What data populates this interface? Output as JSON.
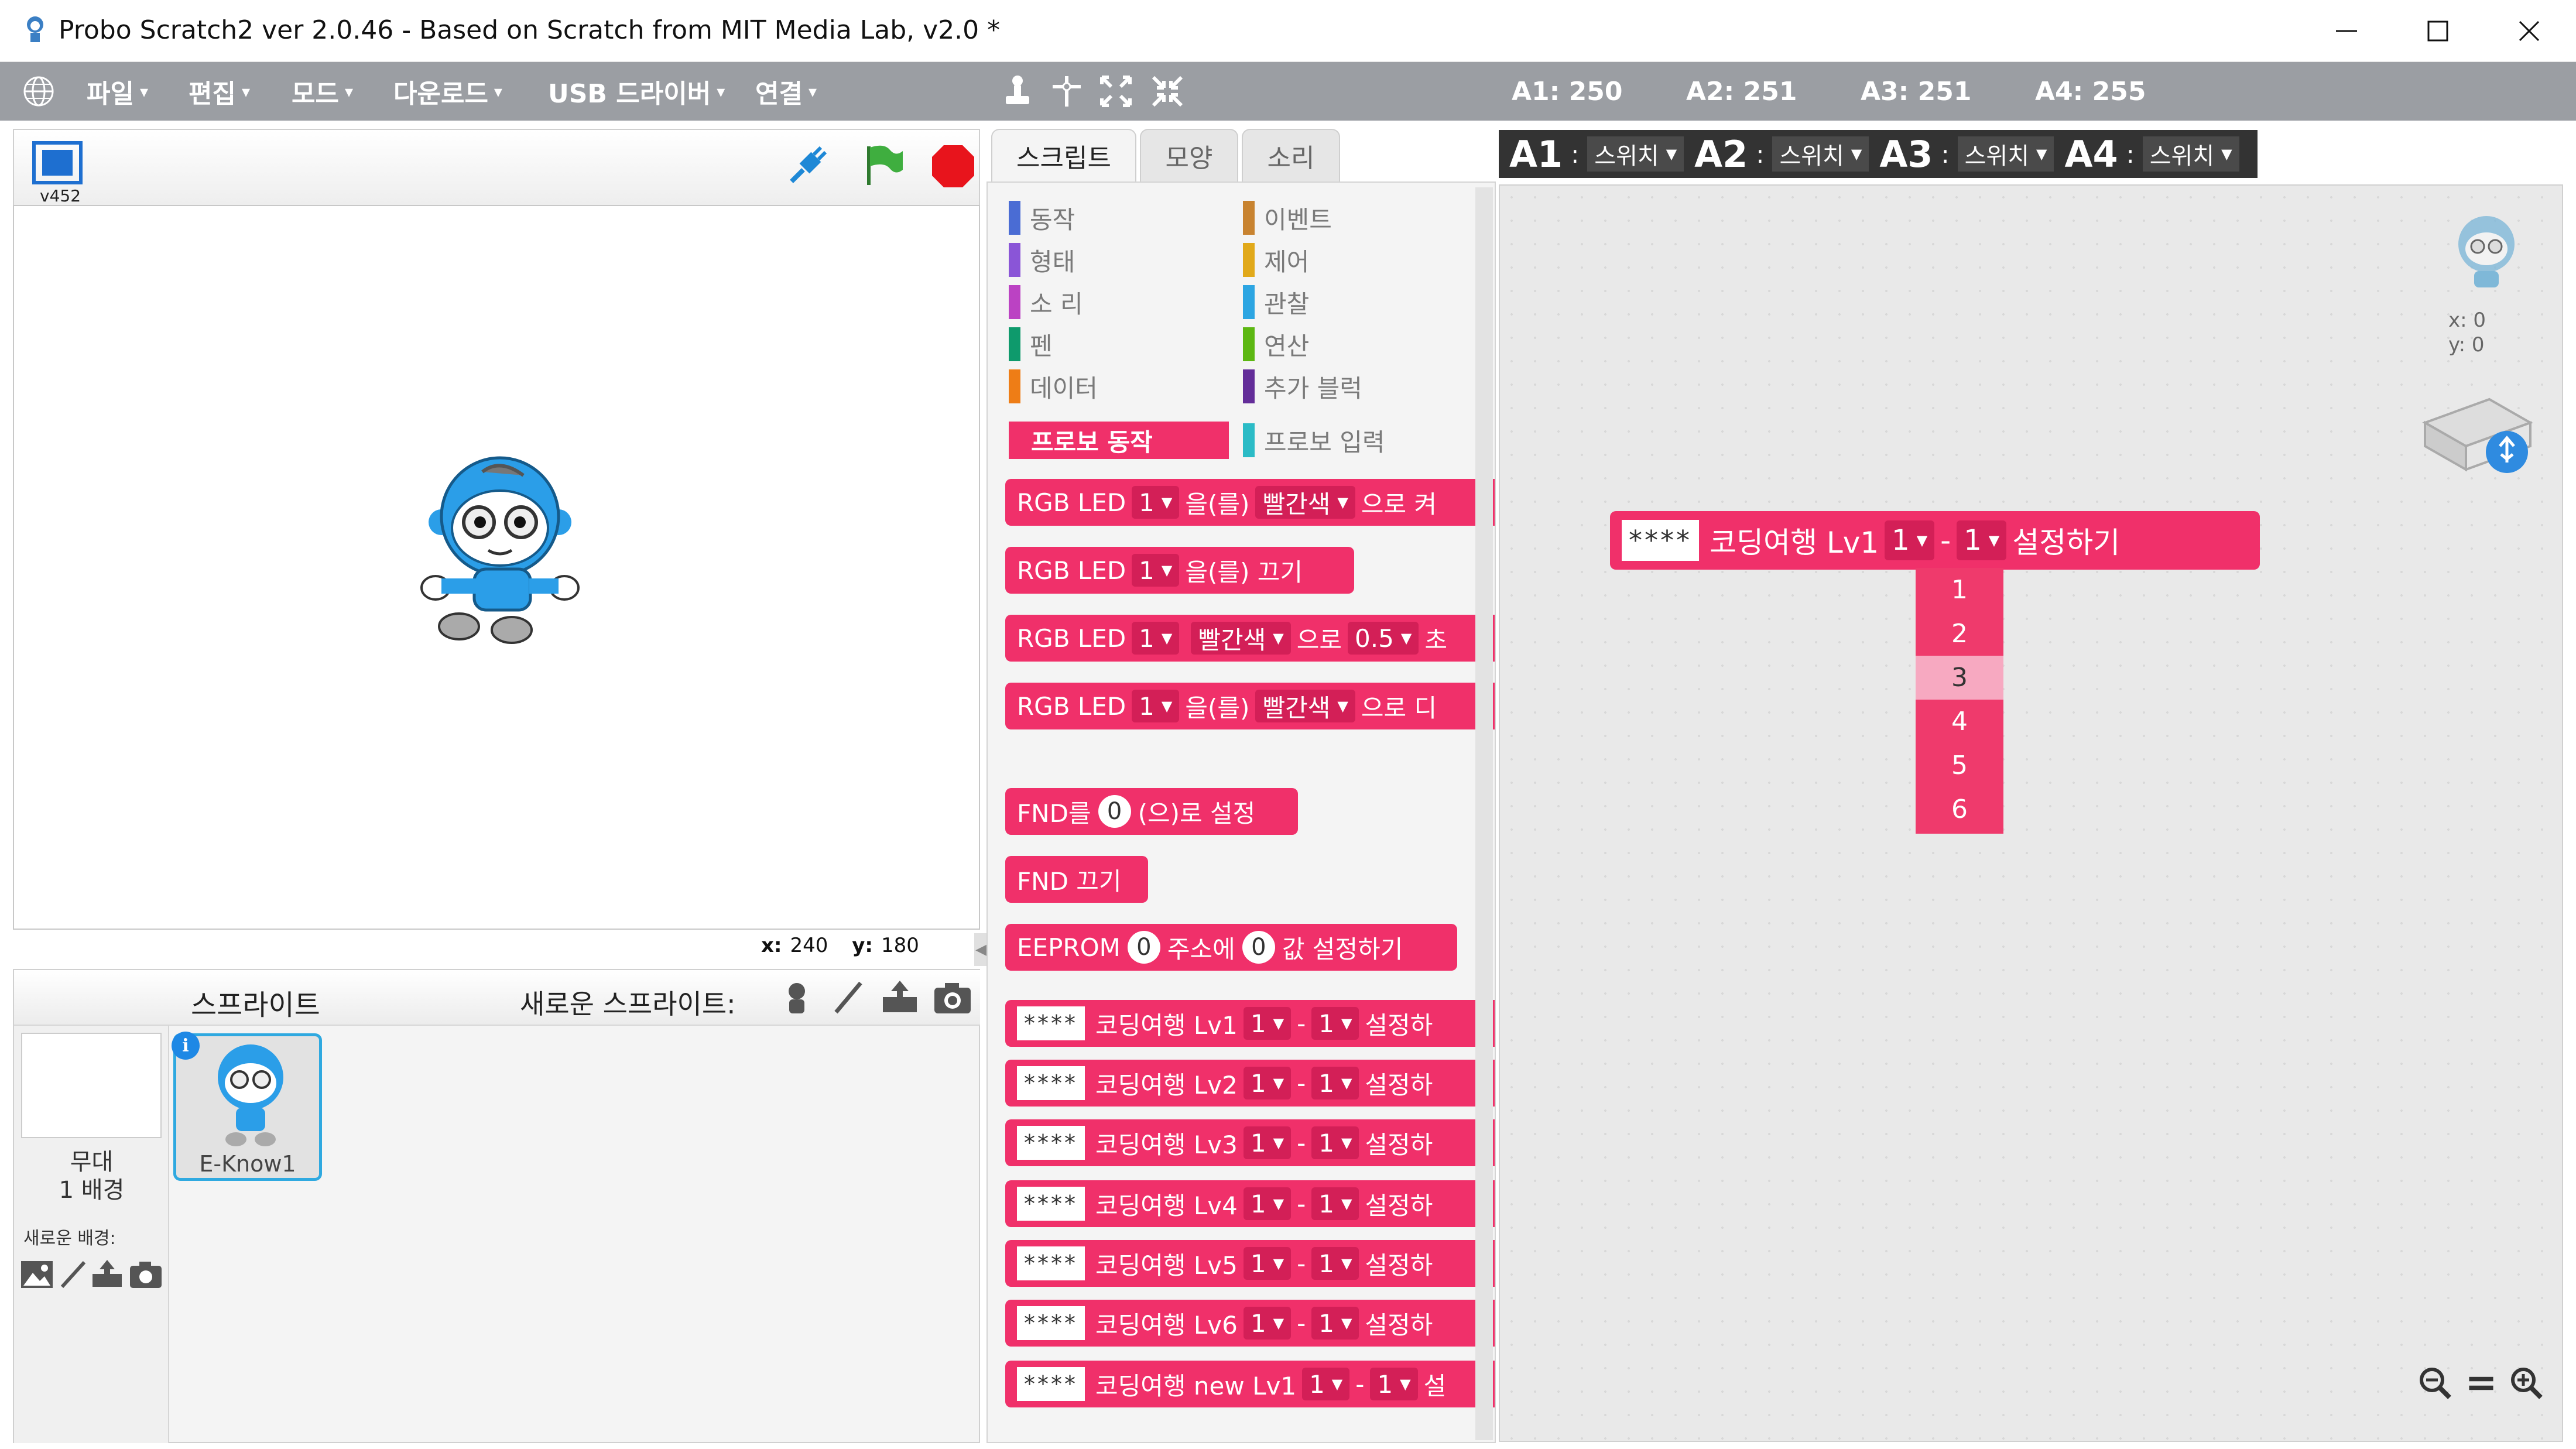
{
  "window": {
    "title": "Probo Scratch2 ver 2.0.46 - Based on Scratch from MIT Media Lab, v2.0 *"
  },
  "menu": {
    "items": [
      {
        "label": "파일"
      },
      {
        "label": "편집"
      },
      {
        "label": "모드"
      },
      {
        "label": "다운로드"
      },
      {
        "label": "USB 드라이버"
      },
      {
        "label": "연결"
      }
    ],
    "caret": "▾"
  },
  "sensors": [
    "A1: 250",
    "A2: 251",
    "A3: 251",
    "A4: 255"
  ],
  "stage": {
    "version": "v452",
    "coords": {
      "x_label": "x:",
      "x": "240",
      "y_label": "y:",
      "y": "180"
    }
  },
  "tabs": [
    {
      "label": "스크립트"
    },
    {
      "label": "모양"
    },
    {
      "label": "소리"
    }
  ],
  "categories_left": [
    {
      "label": "동작",
      "color": "#4a6cd4"
    },
    {
      "label": "형태",
      "color": "#8a55d7"
    },
    {
      "label": "소 리",
      "color": "#bb42c3"
    },
    {
      "label": "펜",
      "color": "#0e9a6c"
    },
    {
      "label": "데이터",
      "color": "#ee7d16"
    }
  ],
  "categories_right": [
    {
      "label": "이벤트",
      "color": "#c88330"
    },
    {
      "label": "제어",
      "color": "#e1a91a"
    },
    {
      "label": "관찰",
      "color": "#2ca5e2"
    },
    {
      "label": "연산",
      "color": "#5cb712"
    },
    {
      "label": "추가 블럭",
      "color": "#632d99"
    }
  ],
  "active_category": "프로보 동작",
  "other_category": {
    "label": "프로보 입력",
    "color": "#2bbbc6"
  },
  "blocks": {
    "rgb1": {
      "a": "RGB LED",
      "s1": "1",
      "b": "을(를)",
      "s2": "빨간색",
      "c": "으로 켜"
    },
    "rgb2": {
      "a": "RGB LED",
      "s1": "1",
      "b": "을(를) 끄기"
    },
    "rgb3": {
      "a": "RGB LED",
      "s1": "1",
      "s2": "빨간색",
      "b": "으로",
      "s3": "0.5",
      "c": "초"
    },
    "rgb4": {
      "a": "RGB LED",
      "s1": "1",
      "b": "을(를)",
      "s2": "빨간색",
      "c": "으로 디"
    },
    "fnd1": {
      "a": "FND를",
      "v": "0",
      "b": "(으)로 설정"
    },
    "fnd2": {
      "a": "FND 끄기"
    },
    "eeprom": {
      "a": "EEPROM",
      "v1": "0",
      "b": "주소에",
      "v2": "0",
      "c": "값 설정하기"
    },
    "coding": [
      {
        "text": "****",
        "label": "코딩여행 Lv1",
        "s1": "1",
        "dash": "-",
        "s2": "1",
        "tail": "설정하"
      },
      {
        "text": "****",
        "label": "코딩여행 Lv2",
        "s1": "1",
        "dash": "-",
        "s2": "1",
        "tail": "설정하"
      },
      {
        "text": "****",
        "label": "코딩여행 Lv3",
        "s1": "1",
        "dash": "-",
        "s2": "1",
        "tail": "설정하"
      },
      {
        "text": "****",
        "label": "코딩여행 Lv4",
        "s1": "1",
        "dash": "-",
        "s2": "1",
        "tail": "설정하"
      },
      {
        "text": "****",
        "label": "코딩여행 Lv5",
        "s1": "1",
        "dash": "-",
        "s2": "1",
        "tail": "설정하"
      },
      {
        "text": "****",
        "label": "코딩여행 Lv6",
        "s1": "1",
        "dash": "-",
        "s2": "1",
        "tail": "설정하"
      },
      {
        "text": "****",
        "label": "코딩여행 new Lv1",
        "s1": "1",
        "dash": "-",
        "s2": "1",
        "tail": "설"
      }
    ]
  },
  "switch_bar": [
    {
      "label": "A1",
      "colon": ":",
      "value": "스위치"
    },
    {
      "label": "A2",
      "colon": ":",
      "value": "스위치"
    },
    {
      "label": "A3",
      "colon": ":",
      "value": "스위치"
    },
    {
      "label": "A4",
      "colon": ":",
      "value": "스위치"
    }
  ],
  "script_block": {
    "text": "****",
    "label": "코딩여행 Lv1",
    "s1": "1",
    "dash": "-",
    "s2": "1",
    "tail": "설정하기"
  },
  "dropdown": {
    "options": [
      "1",
      "2",
      "3",
      "4",
      "5",
      "6"
    ],
    "highlighted": "3"
  },
  "sprite_info": {
    "x_label": "x:",
    "x": "0",
    "y_label": "y:",
    "y": "0"
  },
  "sprites": {
    "header": "스프라이트",
    "new_sprite": "새로운 스프라이트:",
    "stage_label": "무대",
    "backdrops": "1 배경",
    "new_backdrop": "새로운 배경:",
    "sprite_name": "E-Know1"
  },
  "colors": {
    "block": "#f0306a",
    "slot": "#d31f57",
    "menubar": "#9b9ea3",
    "selection": "#2fa9e0"
  }
}
